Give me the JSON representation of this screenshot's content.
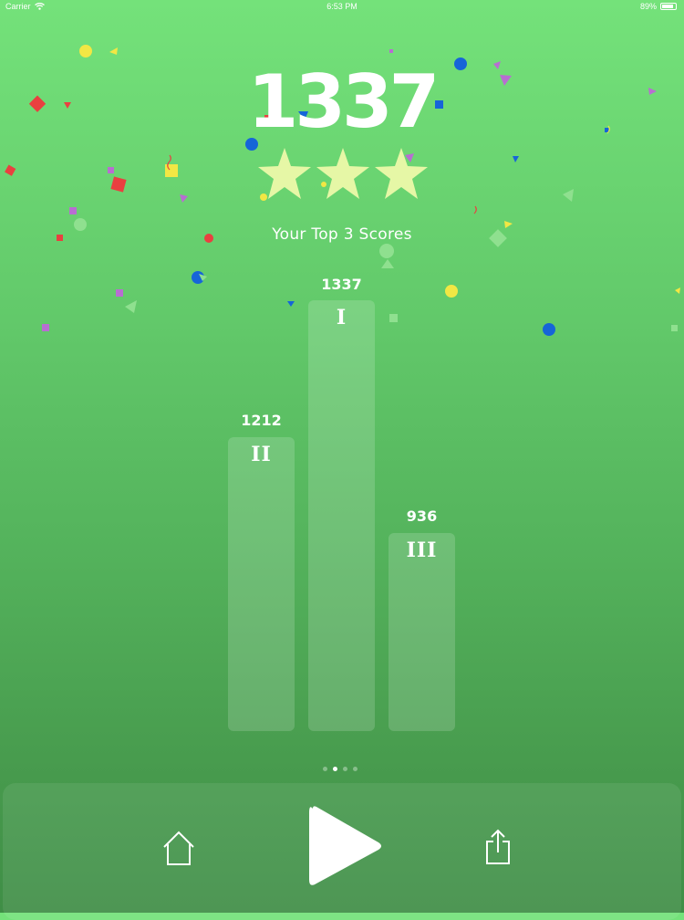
{
  "status_bar": {
    "carrier": "Carrier",
    "time": "6:53 PM",
    "battery": "89%",
    "icons": [
      "wifi-icon",
      "battery-icon"
    ]
  },
  "score": {
    "current": "1337",
    "stars_earned": 3,
    "stars_total": 3
  },
  "top_scores": {
    "title": "Your Top 3 Scores",
    "entries": [
      {
        "rank": "I",
        "score": "1337"
      },
      {
        "rank": "II",
        "score": "1212"
      },
      {
        "rank": "III",
        "score": "936"
      }
    ]
  },
  "pager": {
    "count": 4,
    "active_index": 1
  },
  "toolbar": {
    "icons": [
      "home-icon",
      "play-icon",
      "share-icon"
    ]
  },
  "colors": {
    "background_top": "#74e27a",
    "background_bottom": "#3f8e46",
    "star": "#e6f7a6",
    "text": "#ffffff"
  }
}
